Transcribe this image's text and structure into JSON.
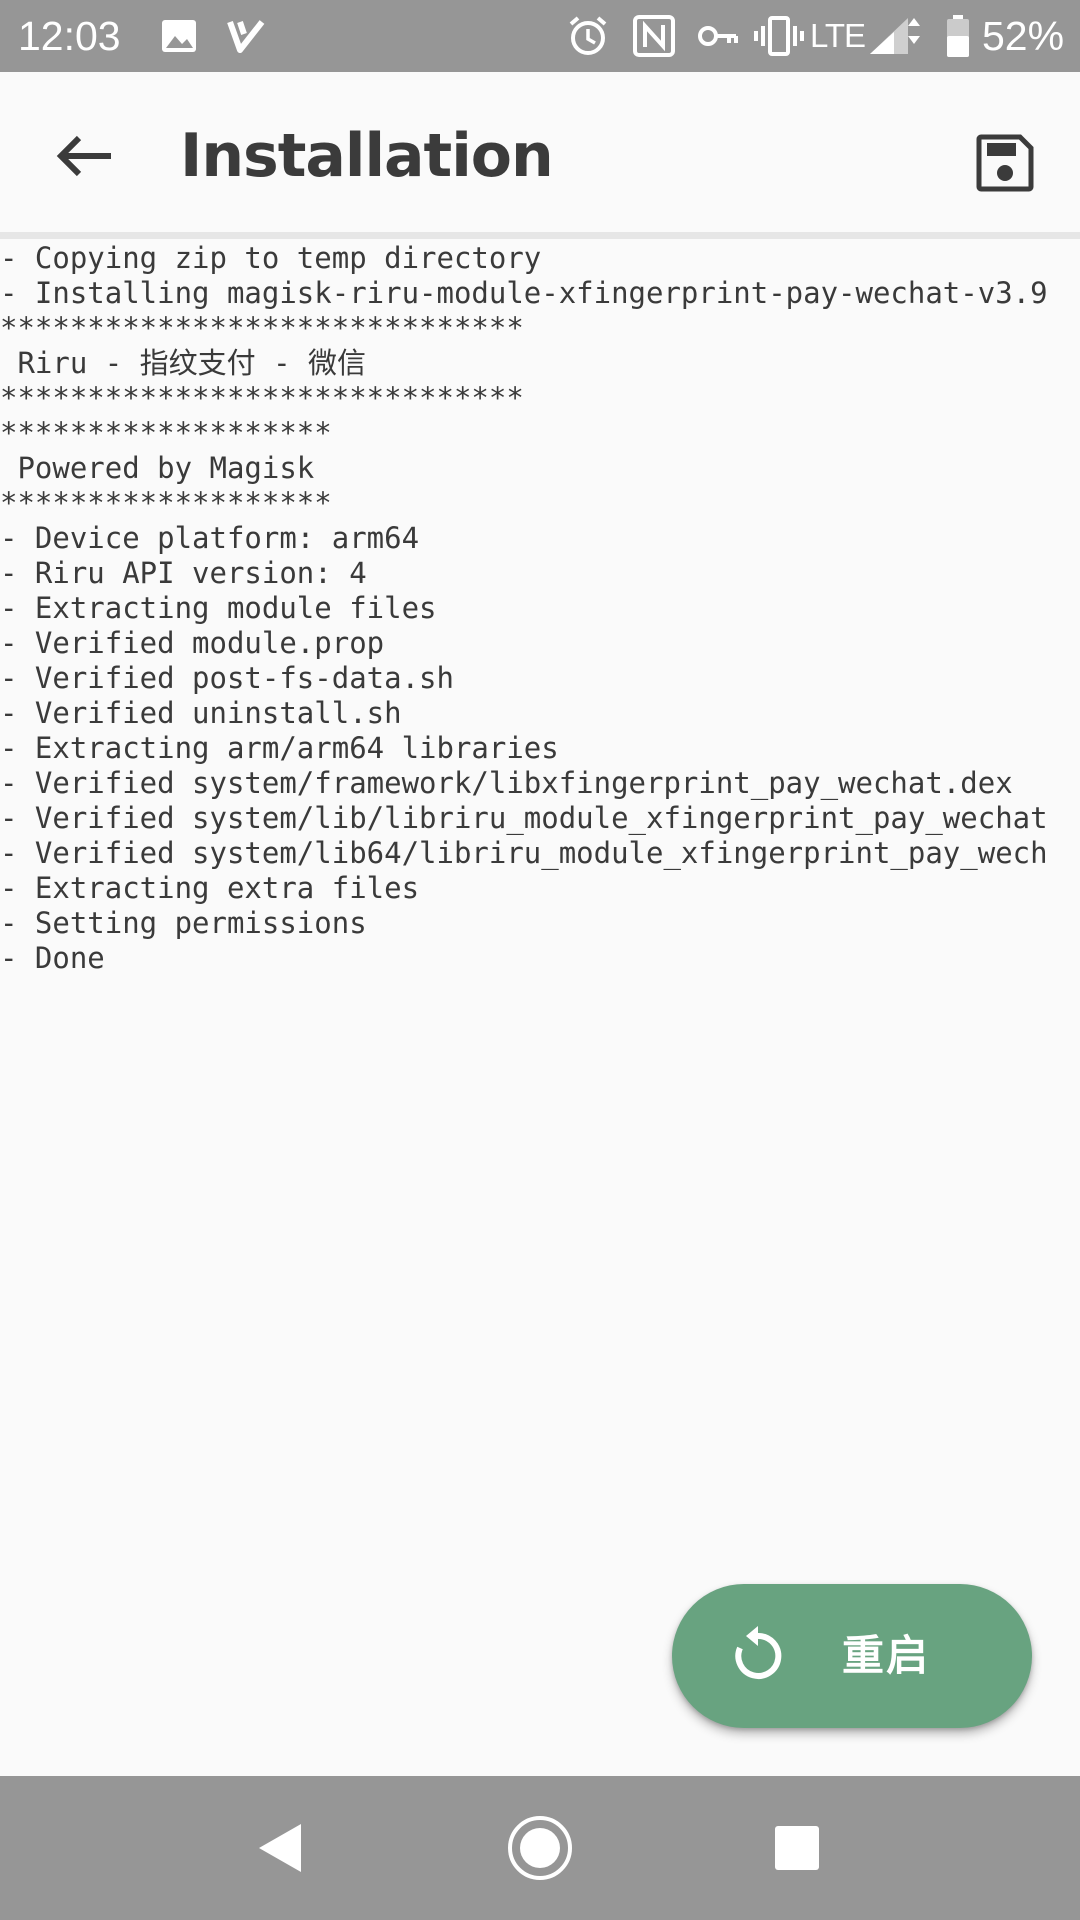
{
  "status_bar": {
    "time": "12:03",
    "network": "LTE",
    "battery_percent": "52%",
    "icons": [
      "image-icon",
      "check-v-icon",
      "alarm-icon",
      "nfc-icon",
      "vpn-key-icon",
      "vibrate-icon",
      "signal-icon",
      "battery-icon"
    ]
  },
  "app_bar": {
    "title": "Installation",
    "back_icon": "arrow-left-icon",
    "save_icon": "save-icon"
  },
  "console": {
    "lines": [
      "- Copying zip to temp directory",
      "- Installing magisk-riru-module-xfingerprint-pay-wechat-v3.9",
      "******************************",
      " Riru - 指纹支付 - 微信",
      "******************************",
      "*******************",
      " Powered by Magisk",
      "*******************",
      "- Device platform: arm64",
      "- Riru API version: 4",
      "- Extracting module files",
      "- Verified module.prop",
      "- Verified post-fs-data.sh",
      "- Verified uninstall.sh",
      "- Extracting arm/arm64 libraries",
      "- Verified system/framework/libxfingerprint_pay_wechat.dex",
      "- Verified system/lib/libriru_module_xfingerprint_pay_wechat",
      "- Verified system/lib64/libriru_module_xfingerprint_pay_wech",
      "- Extracting extra files",
      "- Setting permissions",
      "- Done"
    ]
  },
  "fab": {
    "label": "重启",
    "icon": "restart-icon",
    "color": "#68a380"
  },
  "nav_bar": {
    "icons": [
      "nav-back-icon",
      "nav-home-icon",
      "nav-recents-icon"
    ]
  }
}
